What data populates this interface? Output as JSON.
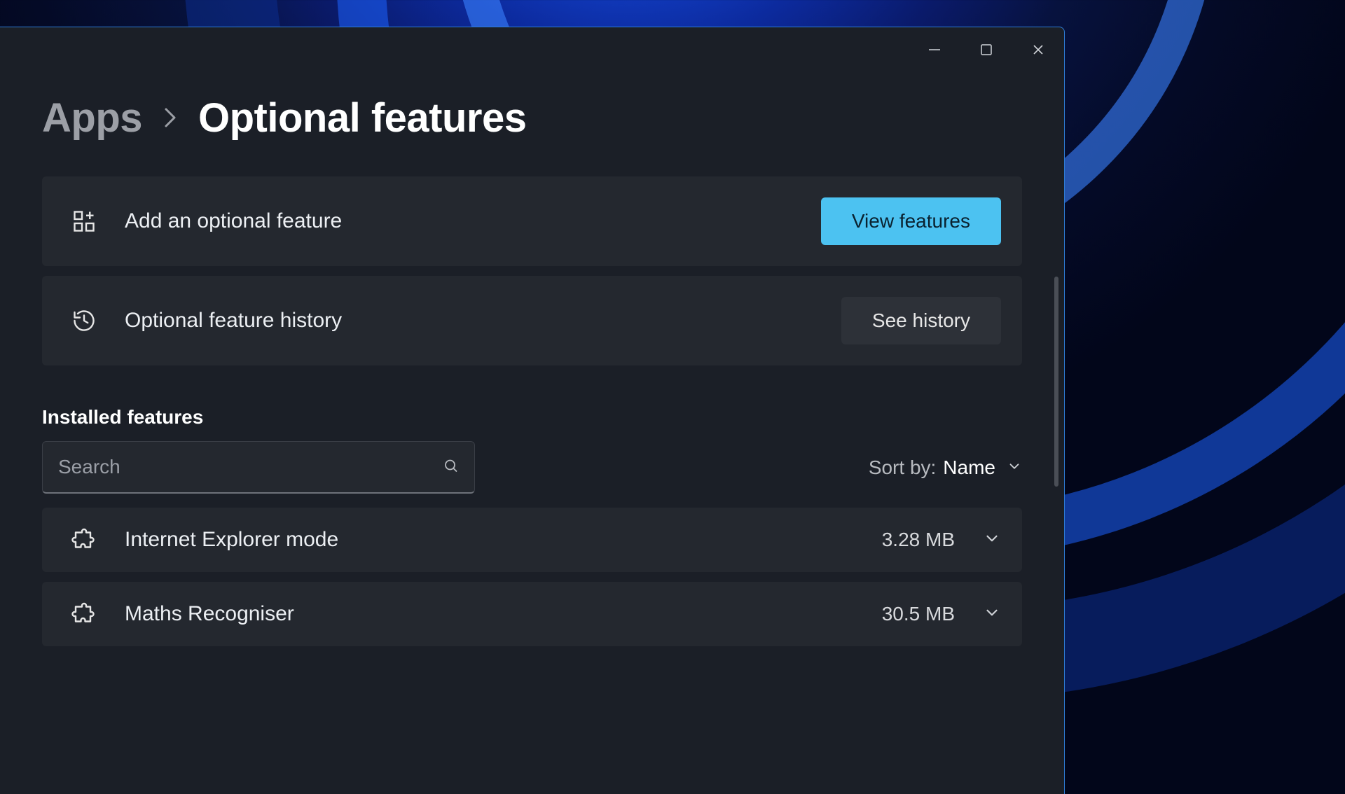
{
  "breadcrumb": {
    "parent": "Apps",
    "title": "Optional features"
  },
  "cards": {
    "add": {
      "label": "Add an optional feature",
      "button": "View features"
    },
    "history": {
      "label": "Optional feature history",
      "button": "See history"
    }
  },
  "section_title": "Installed features",
  "search": {
    "placeholder": "Search",
    "value": ""
  },
  "sort": {
    "label": "Sort by:",
    "value": "Name"
  },
  "features": [
    {
      "name": "Internet Explorer mode",
      "size": "3.28 MB"
    },
    {
      "name": "Maths Recogniser",
      "size": "30.5 MB"
    }
  ]
}
